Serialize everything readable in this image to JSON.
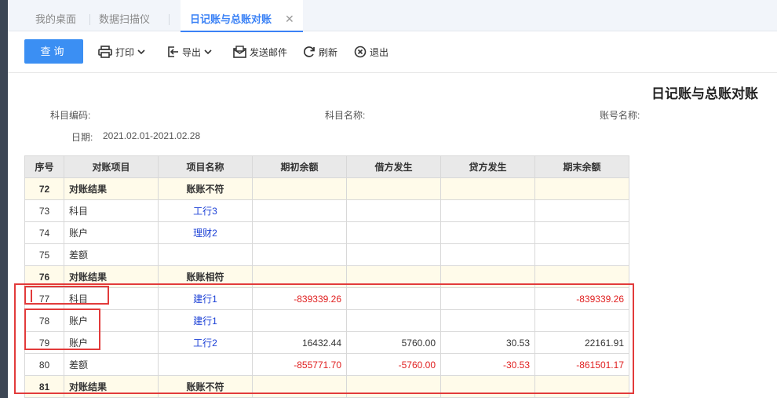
{
  "tabs": [
    {
      "label": "我的桌面"
    },
    {
      "label": "数据扫描仪"
    },
    {
      "label": "日记账与总账对账"
    }
  ],
  "toolbar": {
    "query": "查询",
    "print": "打印",
    "export": "导出",
    "send_mail": "发送邮件",
    "refresh": "刷新",
    "exit": "退出"
  },
  "report": {
    "title": "日记账与总账对账",
    "subject_code_label": "科目编码:",
    "subject_name_label": "科目名称:",
    "account_name_label": "账号名称:",
    "date_label": "日期:",
    "date_value": "2021.02.01-2021.02.28"
  },
  "table": {
    "headers": [
      "序号",
      "对账项目",
      "项目名称",
      "期初余额",
      "借方发生",
      "贷方发生",
      "期末余额"
    ],
    "rows": [
      {
        "idx": "72",
        "item": "对账结果",
        "name": "账账不符",
        "opening": "",
        "debit": "",
        "credit": "",
        "closing": ""
      },
      {
        "idx": "73",
        "item": "科目",
        "name": "工行3",
        "opening": "",
        "debit": "",
        "credit": "",
        "closing": ""
      },
      {
        "idx": "74",
        "item": "账户",
        "name": "理财2",
        "opening": "",
        "debit": "",
        "credit": "",
        "closing": ""
      },
      {
        "idx": "75",
        "item": "差额",
        "name": "",
        "opening": "",
        "debit": "",
        "credit": "",
        "closing": ""
      },
      {
        "idx": "76",
        "item": "对账结果",
        "name": "账账相符",
        "opening": "",
        "debit": "",
        "credit": "",
        "closing": ""
      },
      {
        "idx": "77",
        "item": "科目",
        "name": "建行1",
        "opening": "-839339.26",
        "debit": "",
        "credit": "",
        "closing": "-839339.26"
      },
      {
        "idx": "78",
        "item": "账户",
        "name": "建行1",
        "opening": "",
        "debit": "",
        "credit": "",
        "closing": ""
      },
      {
        "idx": "79",
        "item": "账户",
        "name": "工行2",
        "opening": "16432.44",
        "debit": "5760.00",
        "credit": "30.53",
        "closing": "22161.91"
      },
      {
        "idx": "80",
        "item": "差额",
        "name": "",
        "opening": "-855771.70",
        "debit": "-5760.00",
        "credit": "-30.53",
        "closing": "-861501.17"
      },
      {
        "idx": "81",
        "item": "对账结果",
        "name": "账账不符",
        "opening": "",
        "debit": "",
        "credit": "",
        "closing": ""
      }
    ]
  },
  "colors": {
    "accent": "#3b8ff3",
    "negative": "#e02020",
    "highlight_box": "#e23b3b",
    "result_row": "#fffbea",
    "link_text": "#1a3fd6"
  }
}
